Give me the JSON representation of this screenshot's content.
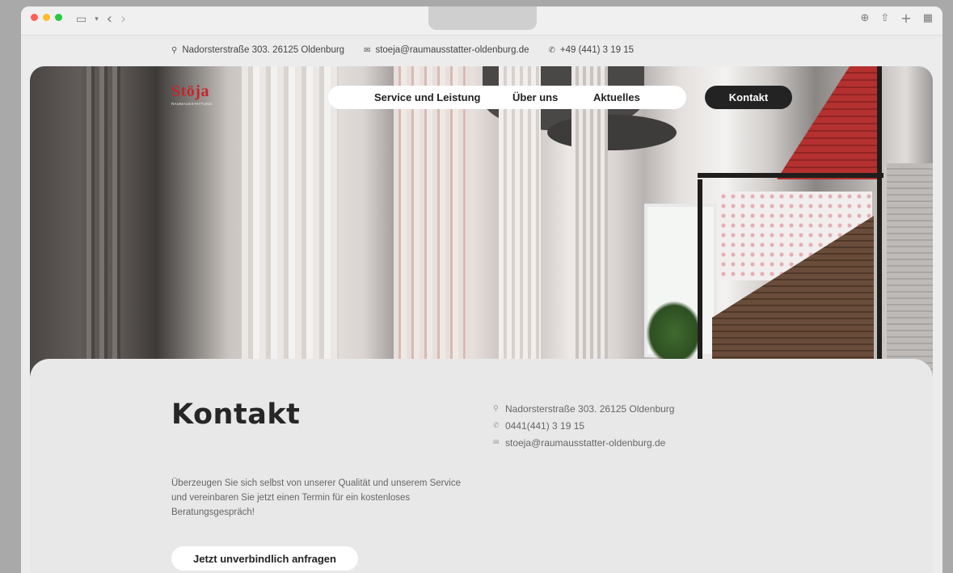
{
  "browser": {
    "icons": [
      "sidebar-icon",
      "chevron-down-icon",
      "back-icon",
      "forward-icon",
      "download-icon",
      "share-icon",
      "new-tab-icon",
      "tab-overview-icon"
    ],
    "traffic_colors": [
      "#ff5f57",
      "#febc2e",
      "#28c840"
    ]
  },
  "infobar": {
    "address": "Nadorsterstraße 303. 26125 Oldenburg",
    "email": "stoeja@raumausstatter-oldenburg.de",
    "phone": "+49 (441) 3 19 15"
  },
  "hero": {
    "logo_main": "Stöja",
    "logo_sub": "RAUMAUSSTATTUNG"
  },
  "nav": {
    "items": [
      "Service und Leistung",
      "Über uns",
      "Aktuelles"
    ],
    "contact_button": "Kontakt"
  },
  "contact_section": {
    "title": "Kontakt",
    "address": "Nadorsterstraße 303. 26125 Oldenburg",
    "phone": "0441(441) 3 19 15",
    "email": "stoeja@raumausstatter-oldenburg.de",
    "intro": "Überzeugen Sie sich selbst von unserer Qualität und unserem Service und vereinbaren Sie jetzt einen Termin für ein kostenloses Beratungsgespräch!",
    "cta": "Jetzt unverbindlich anfragen"
  },
  "colors": {
    "brand_red": "#c4262d",
    "dark_button": "#232323",
    "panel_bg": "#e8e8e8"
  }
}
